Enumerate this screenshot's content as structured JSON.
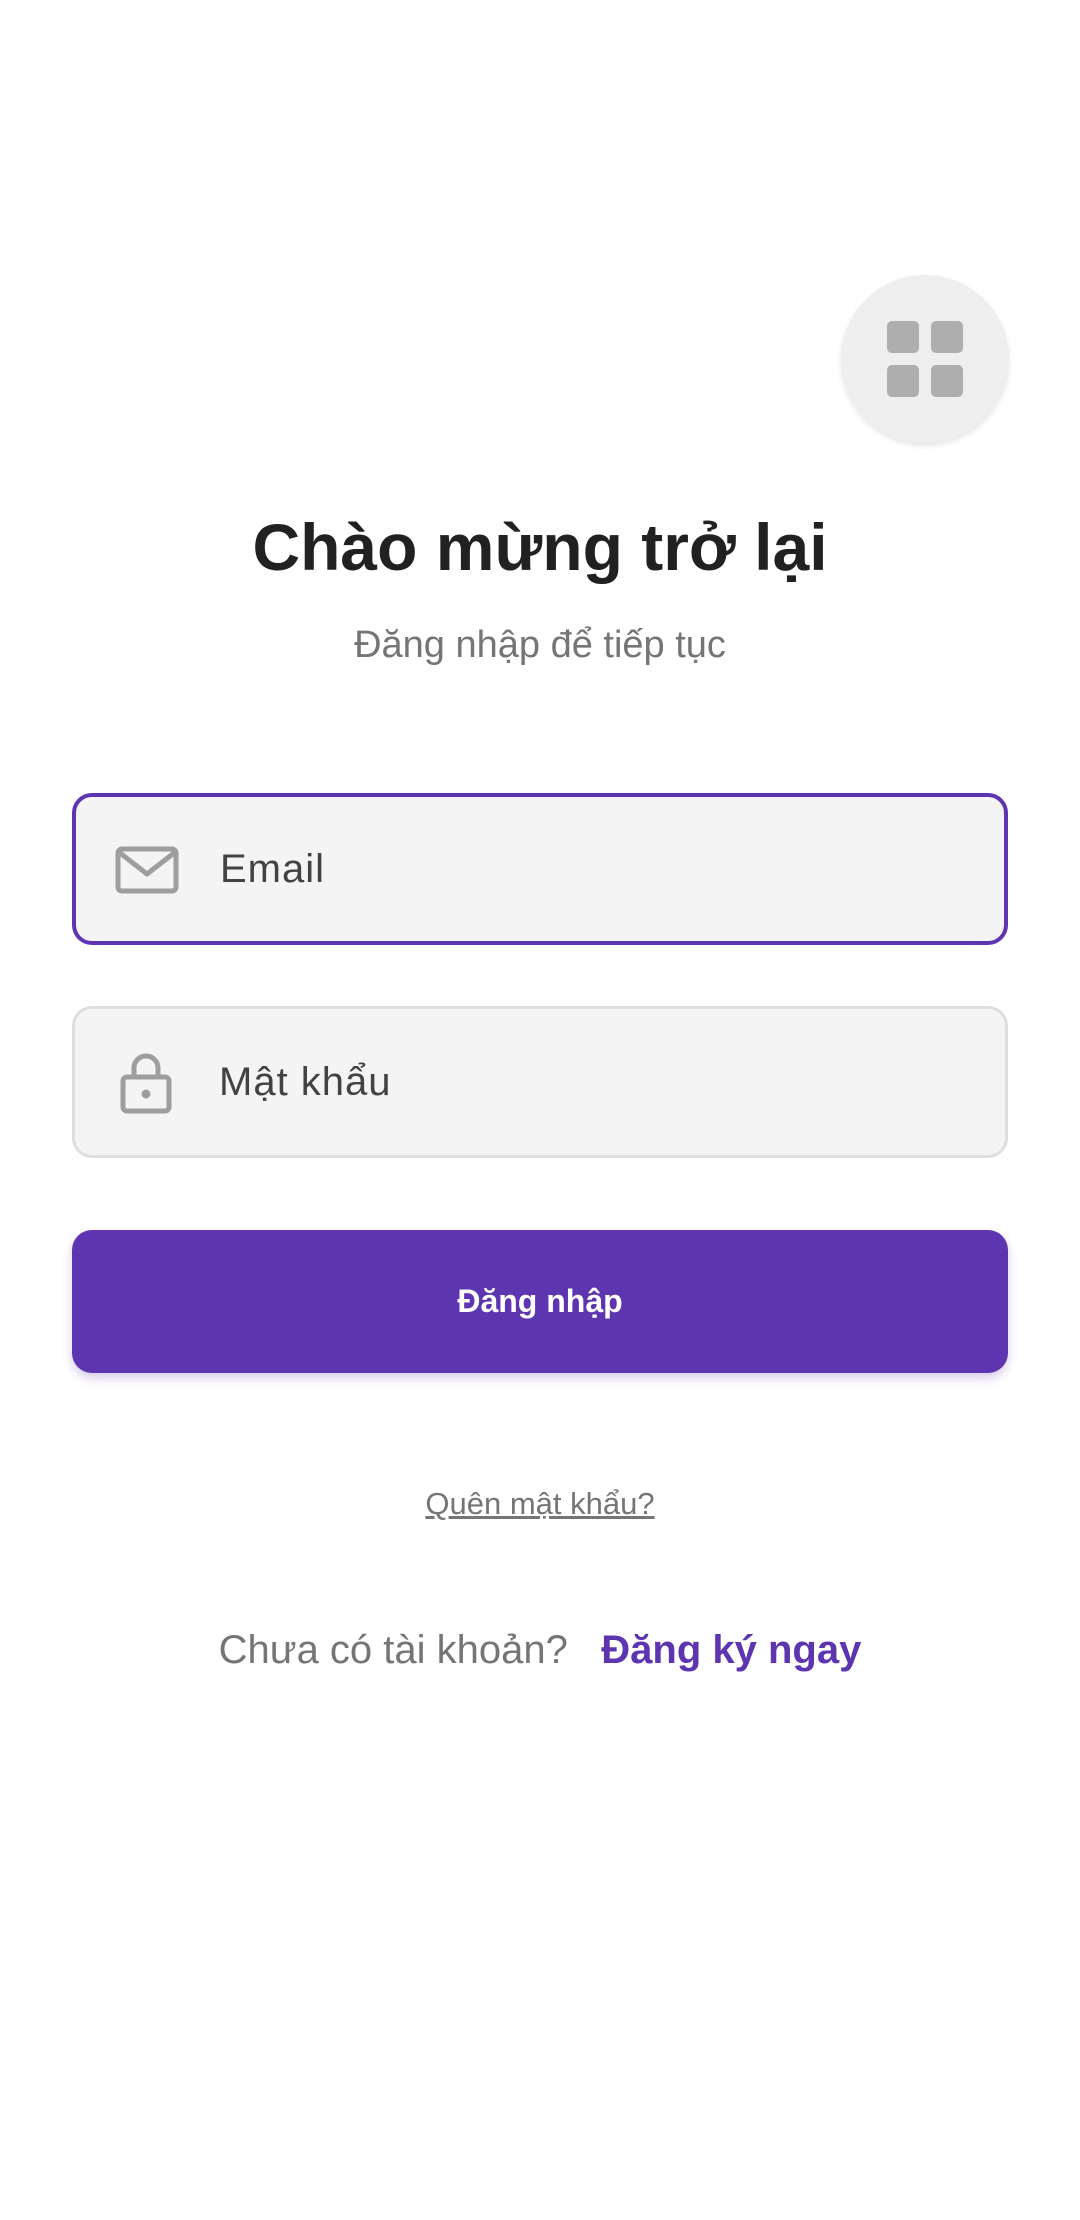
{
  "app": {
    "accent_color": "#5e35b1"
  },
  "menu_button": {
    "icon": "grid-icon"
  },
  "header": {
    "title": "Chào mừng trở lại",
    "subtitle": "Đăng nhập để tiếp tục"
  },
  "form": {
    "email": {
      "icon": "mail-icon",
      "placeholder": "Email",
      "value": ""
    },
    "password": {
      "icon": "lock-icon",
      "placeholder": "Mật khẩu",
      "value": ""
    },
    "submit_label": "Đăng nhập"
  },
  "links": {
    "forgot_password": "Quên mật khẩu?",
    "signup_prompt": "Chưa có tài khoản?",
    "signup_link": "Đăng ký ngay"
  }
}
